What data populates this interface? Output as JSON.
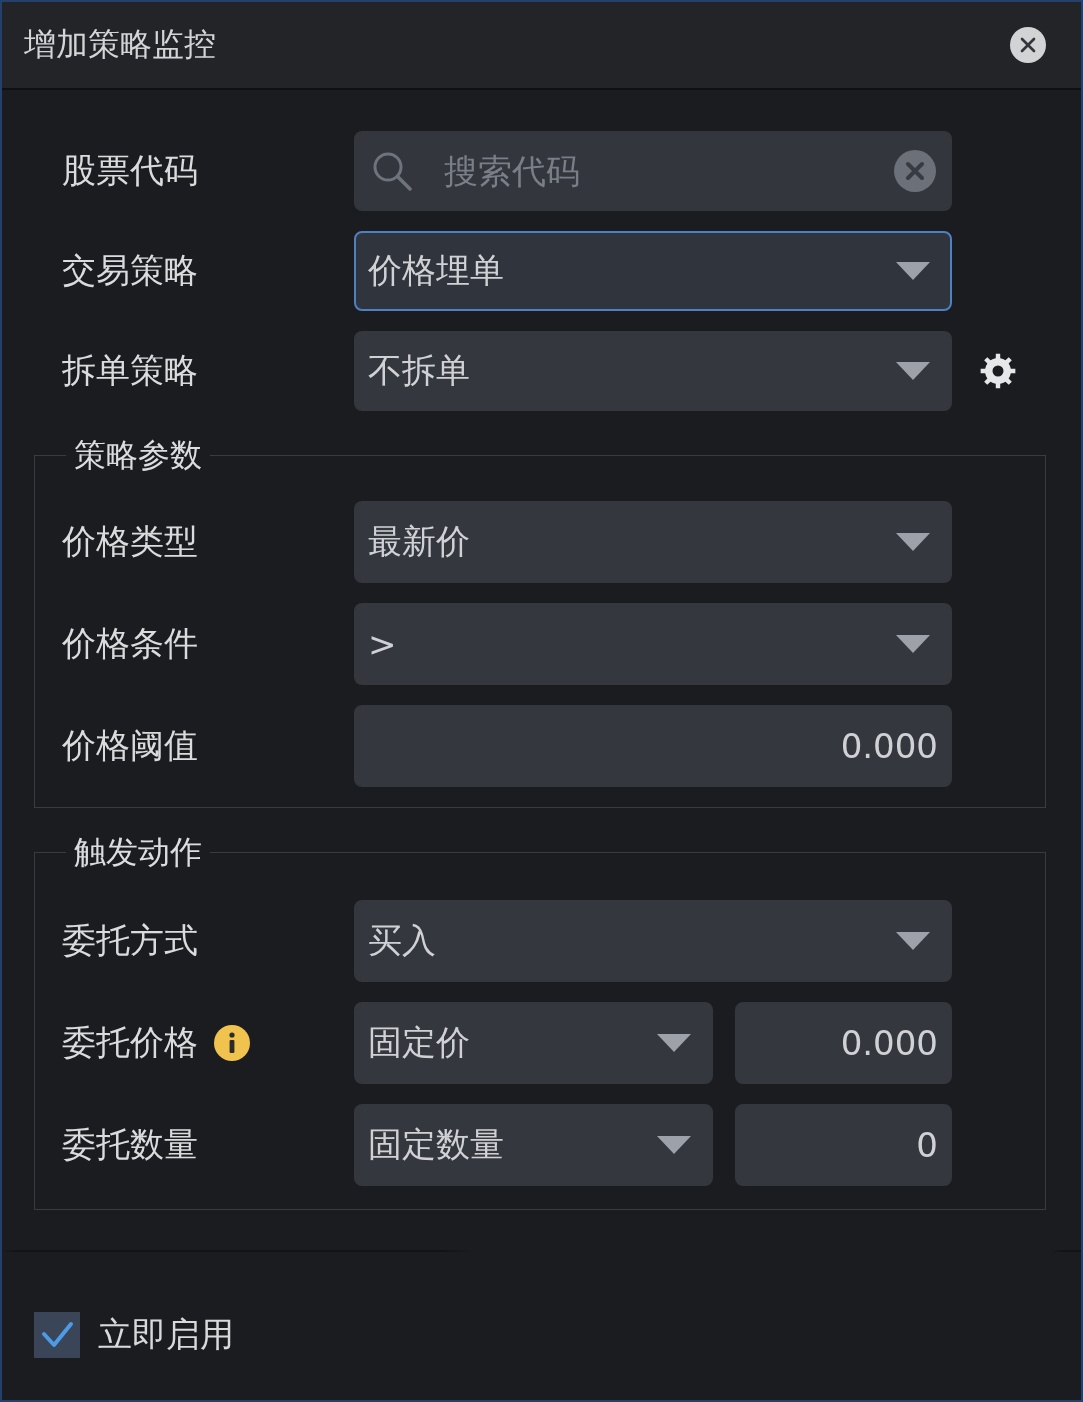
{
  "window": {
    "title": "增加策略监控"
  },
  "fields": [
    {
      "kind": "search",
      "label": "股票代码",
      "placeholder": "搜索代码",
      "focused": false,
      "settings": false
    },
    {
      "kind": "select",
      "label": "交易策略",
      "value": "价格埋单",
      "focused": true,
      "settings": false
    },
    {
      "kind": "select",
      "label": "拆单策略",
      "value": "不拆单",
      "focused": false,
      "settings": true
    }
  ],
  "groups": [
    {
      "title": "策略参数",
      "fields": [
        {
          "kind": "select",
          "label": "价格类型",
          "value": "最新价",
          "info": false
        },
        {
          "kind": "select",
          "label": "价格条件",
          "value": ">",
          "info": false
        },
        {
          "kind": "number",
          "label": "价格阈值",
          "value": "0.000",
          "info": false
        }
      ]
    },
    {
      "title": "触发动作",
      "fields": [
        {
          "kind": "select",
          "label": "委托方式",
          "value": "买入",
          "info": false
        },
        {
          "kind": "select_number",
          "label": "委托价格",
          "value": "固定价",
          "amount": "0.000",
          "info": true
        },
        {
          "kind": "select_number",
          "label": "委托数量",
          "value": "固定数量",
          "amount": "0",
          "info": false
        }
      ]
    }
  ],
  "enable_now": {
    "label": "立即启用",
    "checked": true
  }
}
